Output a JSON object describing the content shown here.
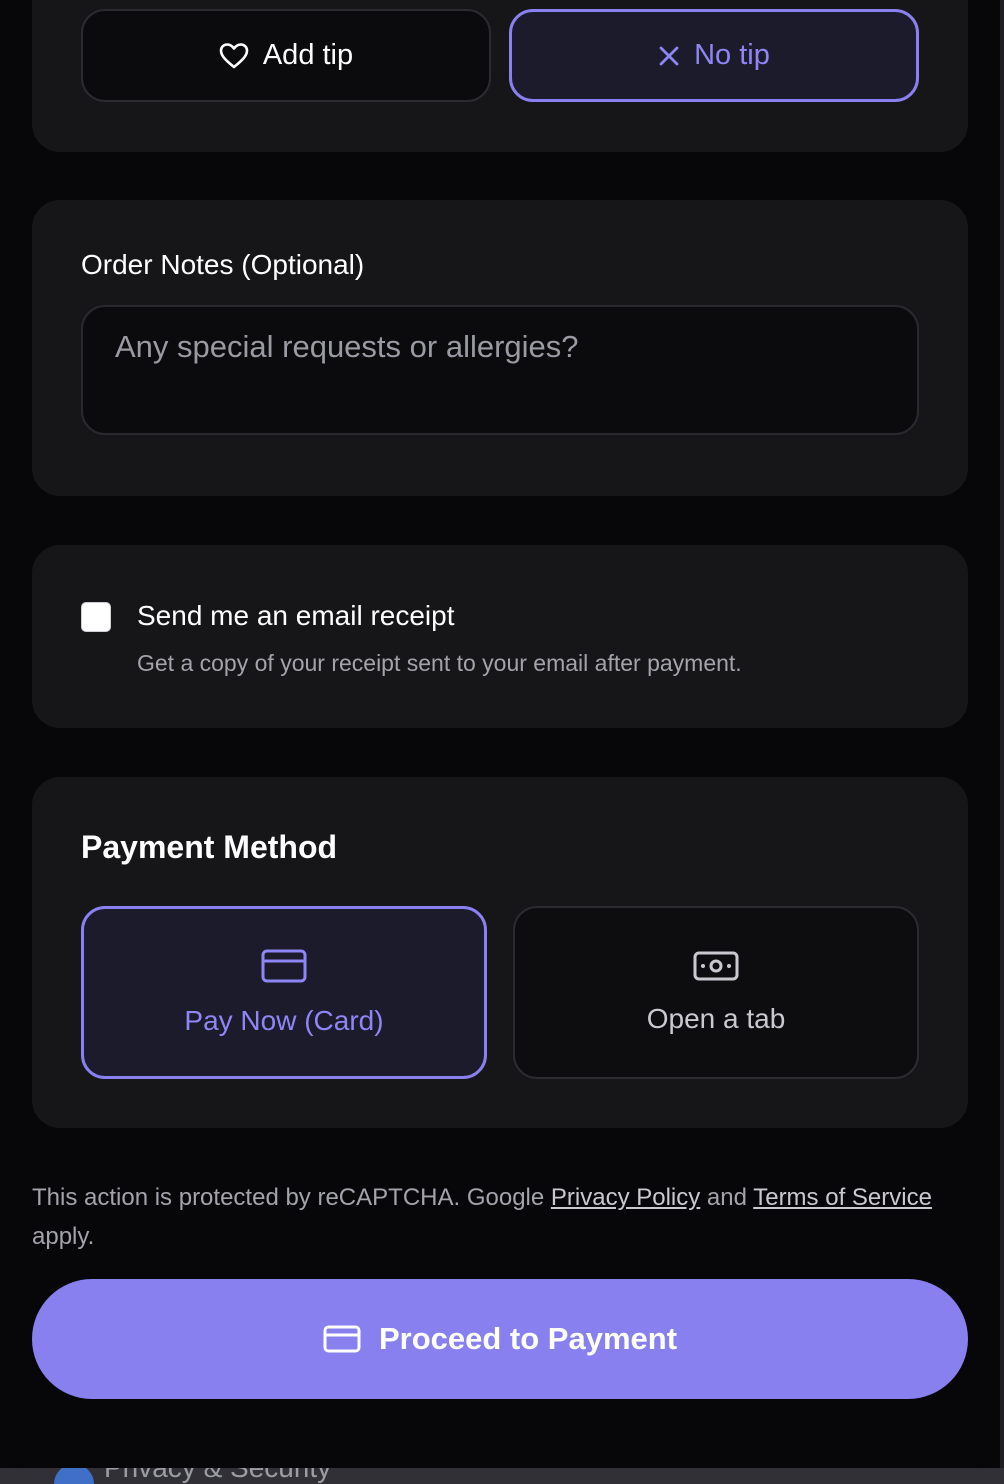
{
  "tip": {
    "add_label": "Add tip",
    "add_icon": "heart-icon",
    "no_label": "No tip",
    "no_icon": "close-icon",
    "selected": "No tip"
  },
  "notes": {
    "label": "Order Notes (Optional)",
    "value": "",
    "placeholder": "Any special requests or allergies?"
  },
  "receipt": {
    "checked": false,
    "title": "Send me an email receipt",
    "subtitle": "Get a copy of your receipt sent to your email after payment."
  },
  "payment_method": {
    "title": "Payment Method",
    "options": [
      {
        "label": "Pay Now (Card)",
        "icon": "credit-card-icon",
        "selected": true
      },
      {
        "label": "Open a tab",
        "icon": "cash-icon",
        "selected": false
      }
    ]
  },
  "legal": {
    "prefix": "This action is protected by reCAPTCHA. Google ",
    "privacy_link": "Privacy Policy",
    "middle": " and ",
    "terms_link": "Terms of Service",
    "suffix": " apply."
  },
  "proceed": {
    "label": "Proceed to Payment",
    "icon": "credit-card-icon"
  },
  "bottom_peek": {
    "label": "Privacy & Security"
  },
  "colors": {
    "accent": "#8780ee",
    "accent_text": "#8f86f5",
    "card_bg": "#161619",
    "page_bg": "#070709"
  }
}
